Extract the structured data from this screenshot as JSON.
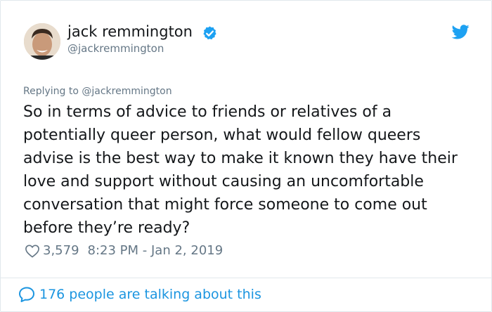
{
  "author": {
    "display_name": "jack remmington",
    "handle": "@jackremmington",
    "verified": true
  },
  "tweet": {
    "replying_to": "Replying to @jackremmington",
    "text": "So in terms of advice to friends or relatives of a potentially queer person, what would fellow queers advise is the best way to make it known they have their love and support without causing an uncomfortable conversation that might force someone to come out before they’re ready?",
    "likes": "3,579",
    "timestamp": "8:23 PM - Jan 2, 2019"
  },
  "footer": {
    "talking_label": "176 people are talking about this"
  },
  "icons": {
    "verified": "verified-badge-icon",
    "brand": "twitter-bird-icon",
    "like": "heart-icon",
    "reply": "speech-bubble-icon"
  },
  "colors": {
    "accent": "#1b95e0",
    "verified": "#1da1f2",
    "muted": "#657786",
    "text": "#14171a",
    "border": "#e1e8ed"
  }
}
